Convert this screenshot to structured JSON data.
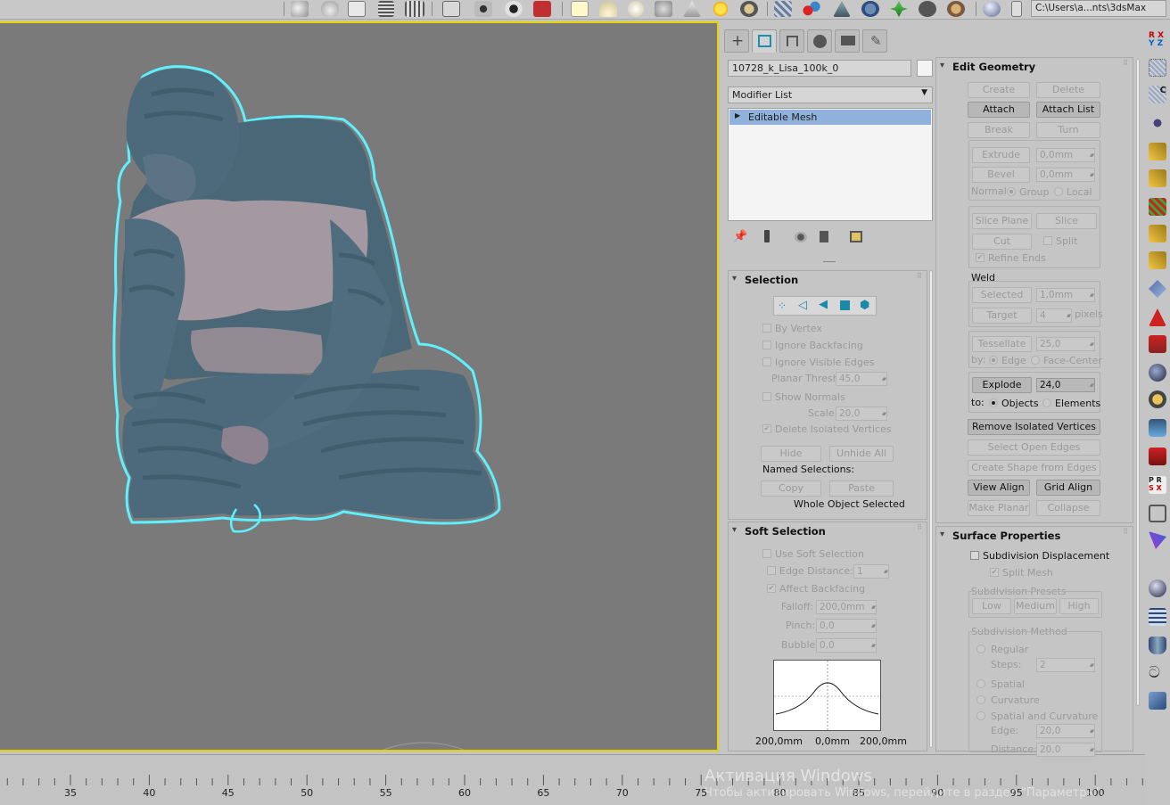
{
  "toolbar": {
    "path": "C:\\Users\\a...nts\\3dsMax"
  },
  "command_panel": {
    "object_name": "10728_k_Lisa_100k_0",
    "modifier_list": "Modifier List",
    "stack_item": "Editable Mesh"
  },
  "selection": {
    "title": "Selection",
    "by_vertex": "By Vertex",
    "ignore_backfacing": "Ignore Backfacing",
    "ignore_visible_edges": "Ignore Visible Edges",
    "planar_thresh": "Planar Thresh:",
    "planar_thresh_value": "45,0",
    "show_normals": "Show Normals",
    "scale": "Scale:",
    "scale_value": "20,0",
    "delete_isolated": "Delete Isolated Vertices",
    "hide": "Hide",
    "unhide_all": "Unhide All",
    "named_selections": "Named Selections:",
    "copy": "Copy",
    "paste": "Paste",
    "status": "Whole Object Selected"
  },
  "soft_selection": {
    "title": "Soft Selection",
    "use_soft": "Use Soft Selection",
    "edge_distance": "Edge Distance:",
    "edge_distance_value": "1",
    "affect_backfacing": "Affect Backfacing",
    "falloff": "Falloff:",
    "falloff_value": "200,0mm",
    "pinch": "Pinch:",
    "pinch_value": "0,0",
    "bubble": "Bubble:",
    "bubble_value": "0,0",
    "curve_left": "200,0mm",
    "curve_mid": "0,0mm",
    "curve_right": "200,0mm"
  },
  "edit_geometry": {
    "title": "Edit Geometry",
    "create": "Create",
    "delete": "Delete",
    "attach": "Attach",
    "attach_list": "Attach List",
    "break": "Break",
    "turn": "Turn",
    "extrude": "Extrude",
    "extrude_value": "0,0mm",
    "bevel": "Bevel",
    "bevel_value": "0,0mm",
    "normal": "Normal:",
    "group": "Group",
    "local": "Local",
    "slice_plane": "Slice Plane",
    "slice": "Slice",
    "cut": "Cut",
    "split": "Split",
    "refine_ends": "Refine Ends",
    "weld": "Weld",
    "selected": "Selected",
    "selected_value": "1,0mm",
    "target": "Target",
    "target_value": "4",
    "pixels": "pixels",
    "tessellate": "Tessellate",
    "tessellate_value": "25,0",
    "by": "by:",
    "edge": "Edge",
    "face_center": "Face-Center",
    "explode": "Explode",
    "explode_value": "24,0",
    "to": "to:",
    "objects": "Objects",
    "elements": "Elements",
    "remove_isolated": "Remove Isolated Vertices",
    "select_open_edges": "Select Open Edges",
    "create_shape": "Create Shape from Edges",
    "view_align": "View Align",
    "grid_align": "Grid Align",
    "make_planar": "Make Planar",
    "collapse": "Collapse"
  },
  "surface_properties": {
    "title": "Surface Properties",
    "subdivision_displacement": "Subdivision Displacement",
    "split_mesh": "Split Mesh",
    "presets": "Subdivision Presets",
    "low": "Low",
    "medium": "Medium",
    "high": "High",
    "method": "Subdivision Method",
    "regular": "Regular",
    "steps": "Steps:",
    "steps_value": "2",
    "spatial": "Spatial",
    "curvature": "Curvature",
    "spatial_curvature": "Spatial and Curvature",
    "edge": "Edge:",
    "edge_value": "20,0",
    "distance": "Distance:",
    "distance_value": "20,0"
  },
  "timeline": {
    "labels": [
      "35",
      "40",
      "45",
      "50",
      "55",
      "60",
      "65",
      "70",
      "75",
      "80",
      "85",
      "90",
      "95",
      "100"
    ]
  },
  "watermark": {
    "line1": "Активация Windows",
    "line2": "Чтобы активировать Windows, перейдите в раздел \"Параметры\"."
  },
  "colors": {
    "viewport_bg": "#7a7a7a",
    "active_border": "#e6d200",
    "selection_outline": "#5ff0ff",
    "sweater": "#4a6778",
    "skin": "#8e8190",
    "stack_highlight": "#8fb1dc"
  }
}
